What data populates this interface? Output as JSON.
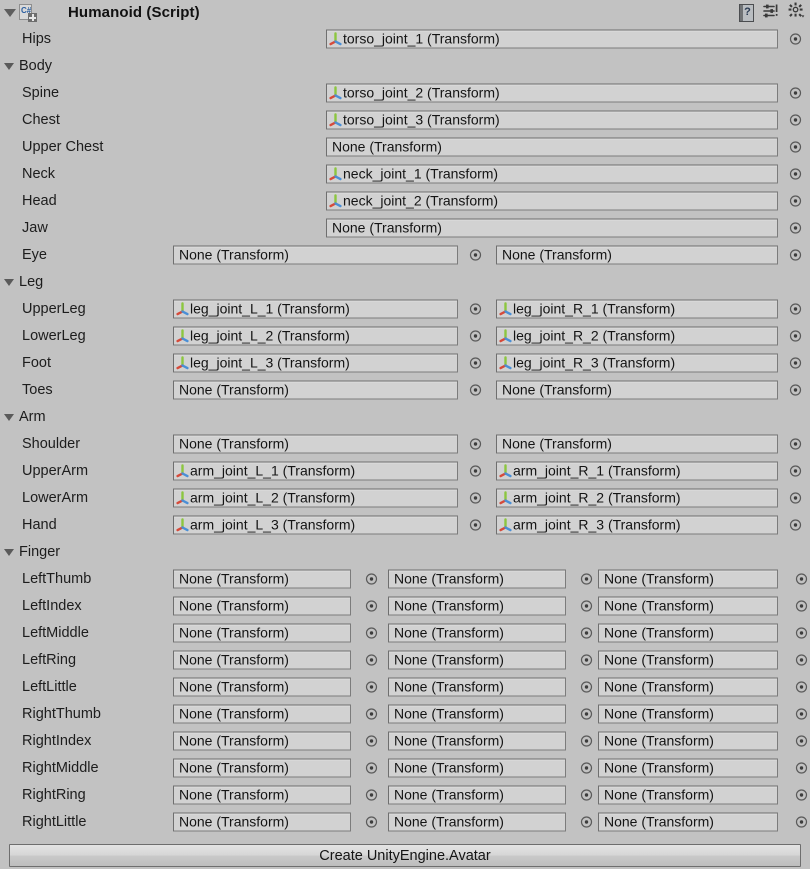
{
  "header": {
    "title": "Humanoid (Script)",
    "script_icon": "script-icon",
    "foldout_icon": "foldout-triangle-icon",
    "help_icon": "help-book-icon",
    "help_glyph": "?",
    "preset_icon": "preset-sliders-icon",
    "settings_icon": "gear-icon"
  },
  "colors": {
    "background": "#c2c2c2",
    "field_bg": "#d2d2d2",
    "field_border": "#7c7c7c",
    "text": "#1d1d1d",
    "axis_red": "#d64a3a",
    "axis_green": "#8cc63f",
    "axis_blue": "#4a8fd6"
  },
  "labels": {
    "none": "None (Transform)",
    "transform_icon": "transform-axis-icon",
    "picker_icon": "object-picker-icon"
  },
  "rows": [
    {
      "kind": "field1",
      "label": "Hips",
      "values": [
        "torso_joint_1 (Transform)"
      ]
    },
    {
      "kind": "section",
      "label": "Body"
    },
    {
      "kind": "field1",
      "label": "Spine",
      "values": [
        "torso_joint_2 (Transform)"
      ]
    },
    {
      "kind": "field1",
      "label": "Chest",
      "values": [
        "torso_joint_3 (Transform)"
      ]
    },
    {
      "kind": "field1",
      "label": "Upper Chest",
      "values": [
        "None (Transform)"
      ]
    },
    {
      "kind": "field1",
      "label": "Neck",
      "values": [
        "neck_joint_1 (Transform)"
      ]
    },
    {
      "kind": "field1",
      "label": "Head",
      "values": [
        "neck_joint_2 (Transform)"
      ]
    },
    {
      "kind": "field1",
      "label": "Jaw",
      "values": [
        "None (Transform)"
      ]
    },
    {
      "kind": "field2",
      "label": "Eye",
      "values": [
        "None (Transform)",
        "None (Transform)"
      ]
    },
    {
      "kind": "section",
      "label": "Leg"
    },
    {
      "kind": "field2",
      "label": "UpperLeg",
      "values": [
        "leg_joint_L_1 (Transform)",
        "leg_joint_R_1 (Transform)"
      ]
    },
    {
      "kind": "field2",
      "label": "LowerLeg",
      "values": [
        "leg_joint_L_2 (Transform)",
        "leg_joint_R_2 (Transform)"
      ]
    },
    {
      "kind": "field2",
      "label": "Foot",
      "values": [
        "leg_joint_L_3 (Transform)",
        "leg_joint_R_3 (Transform)"
      ]
    },
    {
      "kind": "field2",
      "label": "Toes",
      "values": [
        "None (Transform)",
        "None (Transform)"
      ]
    },
    {
      "kind": "section",
      "label": "Arm"
    },
    {
      "kind": "field2",
      "label": "Shoulder",
      "values": [
        "None (Transform)",
        "None (Transform)"
      ]
    },
    {
      "kind": "field2",
      "label": "UpperArm",
      "values": [
        "arm_joint_L_1 (Transform)",
        "arm_joint_R_1 (Transform)"
      ]
    },
    {
      "kind": "field2",
      "label": "LowerArm",
      "values": [
        "arm_joint_L_2 (Transform)",
        "arm_joint_R_2 (Transform)"
      ]
    },
    {
      "kind": "field2",
      "label": "Hand",
      "values": [
        "arm_joint_L_3 (Transform)",
        "arm_joint_R_3 (Transform)"
      ]
    },
    {
      "kind": "section",
      "label": "Finger"
    },
    {
      "kind": "field3",
      "label": "LeftThumb",
      "values": [
        "None (Transform)",
        "None (Transform)",
        "None (Transform)"
      ]
    },
    {
      "kind": "field3",
      "label": "LeftIndex",
      "values": [
        "None (Transform)",
        "None (Transform)",
        "None (Transform)"
      ]
    },
    {
      "kind": "field3",
      "label": "LeftMiddle",
      "values": [
        "None (Transform)",
        "None (Transform)",
        "None (Transform)"
      ]
    },
    {
      "kind": "field3",
      "label": "LeftRing",
      "values": [
        "None (Transform)",
        "None (Transform)",
        "None (Transform)"
      ]
    },
    {
      "kind": "field3",
      "label": "LeftLittle",
      "values": [
        "None (Transform)",
        "None (Transform)",
        "None (Transform)"
      ]
    },
    {
      "kind": "field3",
      "label": "RightThumb",
      "values": [
        "None (Transform)",
        "None (Transform)",
        "None (Transform)"
      ]
    },
    {
      "kind": "field3",
      "label": "RightIndex",
      "values": [
        "None (Transform)",
        "None (Transform)",
        "None (Transform)"
      ]
    },
    {
      "kind": "field3",
      "label": "RightMiddle",
      "values": [
        "None (Transform)",
        "None (Transform)",
        "None (Transform)"
      ]
    },
    {
      "kind": "field3",
      "label": "RightRing",
      "values": [
        "None (Transform)",
        "None (Transform)",
        "None (Transform)"
      ]
    },
    {
      "kind": "field3",
      "label": "RightLittle",
      "values": [
        "None (Transform)",
        "None (Transform)",
        "None (Transform)"
      ]
    }
  ],
  "footer": {
    "create_button_label": "Create UnityEngine.Avatar"
  }
}
